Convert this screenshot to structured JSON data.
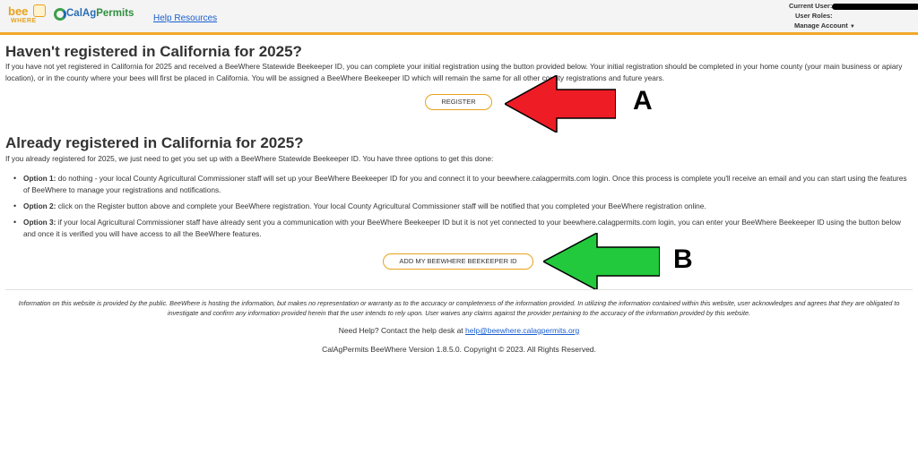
{
  "header": {
    "bee_logo_text": "bee",
    "bee_logo_sub": "WHERE",
    "cal_logo_text_1": "CalAg",
    "cal_logo_text_2": "Permits",
    "help_link": "Help Resources",
    "current_user_label": "Current User:",
    "user_roles_label": "User Roles:",
    "manage_account_label": "Manage Account",
    "accent_color": "#f0a82a"
  },
  "section1": {
    "title": "Haven't registered in California for 2025?",
    "text": "If you have not yet registered in California for 2025 and received a BeeWhere Statewide Beekeeper ID, you can complete your initial registration using the button provided below. Your initial registration should be completed in your home county (your main business or apiary location), or in the county where your bees will first be placed in California. You will be assigned a BeeWhere Beekeeper ID which will remain the same for all other county registrations and future years.",
    "button_label": "REGISTER",
    "annotation": "A"
  },
  "section2": {
    "title": "Already registered in California for 2025?",
    "text": "If you already registered for 2025, we just need to get you set up with a BeeWhere Statewide Beekeeper ID. You have three options to get this done:",
    "options": [
      {
        "label": "Option 1:",
        "text": " do nothing - your local County Agricultural Commissioner staff will set up your BeeWhere Beekeeper ID for you and connect it to your beewhere.calagpermits.com login. Once this process is complete you'll receive an email and you can start using the features of BeeWhere to manage your registrations and notifications."
      },
      {
        "label": "Option 2:",
        "text": " click on the Register button above and complete your BeeWhere registration. Your local County Agricultural Commissioner staff will be notified that you completed your BeeWhere registration online."
      },
      {
        "label": "Option 3:",
        "text": " if your local Agricultural Commissioner staff have already sent you a communication with your BeeWhere Beekeeper ID but it is not yet connected to your beewhere.calagpermits.com login, you can enter your BeeWhere Beekeeper ID using the button below and once it is verified you will have access to all the BeeWhere features."
      }
    ],
    "button_label": "ADD MY BEEWHERE BEEKEEPER ID",
    "annotation": "B"
  },
  "footer": {
    "disclaimer": "Information on this website is provided by the public. BeeWhere is hosting the information, but makes no representation or warranty as to the accuracy or completeness of the information provided. In utilizing the information contained within this website, user acknowledges and agrees that they are obligated to investigate and confirm any information provided herein that the user intends to rely upon. User waives any claims against the provider pertaining to the accuracy of the information provided by this website.",
    "help_text": "Need Help? Contact the help desk at ",
    "help_email": "help@beewhere.calagpermits.org",
    "copyright": "CalAgPermits BeeWhere Version 1.8.5.0. Copyright © 2023. All Rights Reserved."
  },
  "colors": {
    "arrow_red": "#ee1c25",
    "arrow_green": "#22c93d",
    "button_border": "#e8a21b",
    "link": "#1a5fd0"
  }
}
